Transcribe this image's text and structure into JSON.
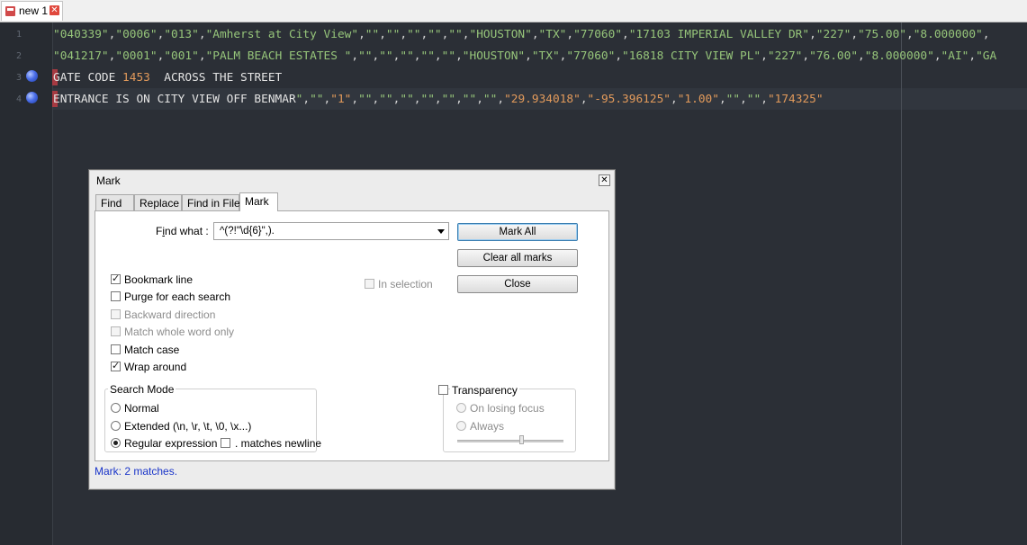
{
  "tab": {
    "label": "new 1",
    "close_glyph": "✕"
  },
  "editor": {
    "line_numbers": [
      "1",
      "2",
      "3",
      "4"
    ],
    "lines": [
      [
        {
          "cls": "s",
          "text": "\"040339\""
        },
        {
          "cls": "p",
          "text": ","
        },
        {
          "cls": "s",
          "text": "\"0006\""
        },
        {
          "cls": "p",
          "text": ","
        },
        {
          "cls": "s",
          "text": "\"013\""
        },
        {
          "cls": "p",
          "text": ","
        },
        {
          "cls": "s",
          "text": "\"Amherst at City View\""
        },
        {
          "cls": "p",
          "text": ","
        },
        {
          "cls": "s",
          "text": "\"\""
        },
        {
          "cls": "p",
          "text": ","
        },
        {
          "cls": "s",
          "text": "\"\""
        },
        {
          "cls": "p",
          "text": ","
        },
        {
          "cls": "s",
          "text": "\"\""
        },
        {
          "cls": "p",
          "text": ","
        },
        {
          "cls": "s",
          "text": "\"\""
        },
        {
          "cls": "p",
          "text": ","
        },
        {
          "cls": "s",
          "text": "\"\""
        },
        {
          "cls": "p",
          "text": ","
        },
        {
          "cls": "s",
          "text": "\"HOUSTON\""
        },
        {
          "cls": "p",
          "text": ","
        },
        {
          "cls": "s",
          "text": "\"TX\""
        },
        {
          "cls": "p",
          "text": ","
        },
        {
          "cls": "s",
          "text": "\"77060\""
        },
        {
          "cls": "p",
          "text": ","
        },
        {
          "cls": "s",
          "text": "\"17103 IMPERIAL VALLEY DR\""
        },
        {
          "cls": "p",
          "text": ","
        },
        {
          "cls": "s",
          "text": "\"227\""
        },
        {
          "cls": "p",
          "text": ","
        },
        {
          "cls": "s",
          "text": "\"75.00\""
        },
        {
          "cls": "p",
          "text": ","
        },
        {
          "cls": "s",
          "text": "\"8.000000\""
        },
        {
          "cls": "p",
          "text": ","
        }
      ],
      [
        {
          "cls": "s",
          "text": "\"041217\""
        },
        {
          "cls": "p",
          "text": ","
        },
        {
          "cls": "s",
          "text": "\"0001\""
        },
        {
          "cls": "p",
          "text": ","
        },
        {
          "cls": "s",
          "text": "\"001\""
        },
        {
          "cls": "p",
          "text": ","
        },
        {
          "cls": "s",
          "text": "\"PALM BEACH ESTATES \""
        },
        {
          "cls": "p",
          "text": ","
        },
        {
          "cls": "s",
          "text": "\"\""
        },
        {
          "cls": "p",
          "text": ","
        },
        {
          "cls": "s",
          "text": "\"\""
        },
        {
          "cls": "p",
          "text": ","
        },
        {
          "cls": "s",
          "text": "\"\""
        },
        {
          "cls": "p",
          "text": ","
        },
        {
          "cls": "s",
          "text": "\"\""
        },
        {
          "cls": "p",
          "text": ","
        },
        {
          "cls": "s",
          "text": "\"\""
        },
        {
          "cls": "p",
          "text": ","
        },
        {
          "cls": "s",
          "text": "\"HOUSTON\""
        },
        {
          "cls": "p",
          "text": ","
        },
        {
          "cls": "s",
          "text": "\"TX\""
        },
        {
          "cls": "p",
          "text": ","
        },
        {
          "cls": "s",
          "text": "\"77060\""
        },
        {
          "cls": "p",
          "text": ","
        },
        {
          "cls": "s",
          "text": "\"16818 CITY VIEW PL\""
        },
        {
          "cls": "p",
          "text": ","
        },
        {
          "cls": "s",
          "text": "\"227\""
        },
        {
          "cls": "p",
          "text": ","
        },
        {
          "cls": "s",
          "text": "\"76.00\""
        },
        {
          "cls": "p",
          "text": ","
        },
        {
          "cls": "s",
          "text": "\"8.000000\""
        },
        {
          "cls": "p",
          "text": ","
        },
        {
          "cls": "s",
          "text": "\"AI\""
        },
        {
          "cls": "p",
          "text": ","
        },
        {
          "cls": "s",
          "text": "\"GA"
        }
      ],
      [
        {
          "cls": "t",
          "text": "GATE CODE "
        },
        {
          "cls": "n",
          "text": "1453"
        },
        {
          "cls": "t",
          "text": "  ACROSS THE STREET"
        }
      ],
      [
        {
          "cls": "t",
          "text": "ENTRANCE IS ON CITY VIEW OFF BENMAR"
        },
        {
          "cls": "s",
          "text": "\""
        },
        {
          "cls": "p",
          "text": ","
        },
        {
          "cls": "s",
          "text": "\"\""
        },
        {
          "cls": "p",
          "text": ","
        },
        {
          "cls": "n",
          "text": "\"1\""
        },
        {
          "cls": "p",
          "text": ","
        },
        {
          "cls": "s",
          "text": "\"\""
        },
        {
          "cls": "p",
          "text": ","
        },
        {
          "cls": "s",
          "text": "\"\""
        },
        {
          "cls": "p",
          "text": ","
        },
        {
          "cls": "s",
          "text": "\"\""
        },
        {
          "cls": "p",
          "text": ","
        },
        {
          "cls": "s",
          "text": "\"\""
        },
        {
          "cls": "p",
          "text": ","
        },
        {
          "cls": "s",
          "text": "\"\""
        },
        {
          "cls": "p",
          "text": ","
        },
        {
          "cls": "s",
          "text": "\"\""
        },
        {
          "cls": "p",
          "text": ","
        },
        {
          "cls": "s",
          "text": "\"\""
        },
        {
          "cls": "p",
          "text": ","
        },
        {
          "cls": "n",
          "text": "\"29.934018\""
        },
        {
          "cls": "p",
          "text": ","
        },
        {
          "cls": "n",
          "text": "\"-95.396125\""
        },
        {
          "cls": "p",
          "text": ","
        },
        {
          "cls": "n",
          "text": "\"1.00\""
        },
        {
          "cls": "p",
          "text": ","
        },
        {
          "cls": "s",
          "text": "\"\""
        },
        {
          "cls": "p",
          "text": ","
        },
        {
          "cls": "s",
          "text": "\"\""
        },
        {
          "cls": "p",
          "text": ","
        },
        {
          "cls": "n",
          "text": "\"174325\""
        }
      ]
    ]
  },
  "dialog": {
    "title": "Mark",
    "close_glyph": "✕",
    "tabs": [
      "Find",
      "Replace",
      "Find in Files",
      "Mark"
    ],
    "active_tab": "Mark",
    "find_what_label_pre": "F",
    "find_what_label_u": "i",
    "find_what_label_post": "nd what :",
    "find_what_value": "^(?!\"\\d{6}\",).",
    "buttons": {
      "mark_all": "Mark All",
      "clear_all_marks": "Clear all marks",
      "close": "Close"
    },
    "in_selection": "In selection",
    "options": {
      "bookmark_line": {
        "label": "Bookmark line",
        "checked": true,
        "disabled": false
      },
      "purge": {
        "label": "Purge for each search",
        "checked": false,
        "disabled": false
      },
      "backward": {
        "label": "Backward direction",
        "checked": false,
        "disabled": true
      },
      "whole_word": {
        "label": "Match whole word only",
        "checked": false,
        "disabled": true
      },
      "match_case": {
        "label": "Match case",
        "checked": false,
        "disabled": false
      },
      "wrap_around": {
        "label": "Wrap around",
        "checked": true,
        "disabled": false
      }
    },
    "search_mode": {
      "title": "Search Mode",
      "normal": "Normal",
      "extended": "Extended (\\n, \\r, \\t, \\0, \\x...)",
      "regex": "Regular expression",
      "matches_newline": ". matches newline",
      "selected": "regex"
    },
    "transparency": {
      "title": "Transparency",
      "on_losing_focus": "On losing focus",
      "always": "Always",
      "level": 0.6
    },
    "status": "Mark: 2 matches."
  }
}
